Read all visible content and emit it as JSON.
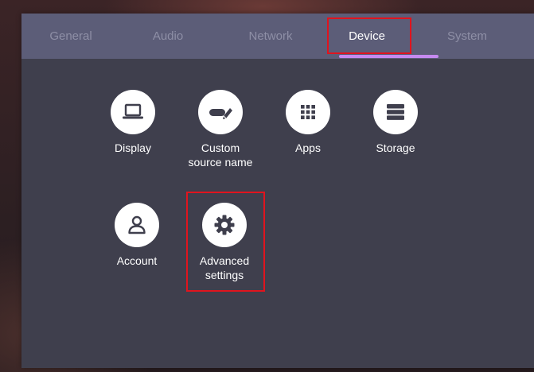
{
  "tabs": [
    {
      "label": "General",
      "active": false
    },
    {
      "label": "Audio",
      "active": false
    },
    {
      "label": "Network",
      "active": false
    },
    {
      "label": "Device",
      "active": true
    },
    {
      "label": "System",
      "active": false
    }
  ],
  "device_items": [
    {
      "label": "Display",
      "icon": "laptop-icon"
    },
    {
      "label": "Custom\nsource name",
      "icon": "tag-pen-icon"
    },
    {
      "label": "Apps",
      "icon": "apps-grid-icon"
    },
    {
      "label": "Storage",
      "icon": "storage-icon"
    },
    {
      "label": "Account",
      "icon": "person-icon"
    },
    {
      "label": "Advanced\nsettings",
      "icon": "gear-icon"
    }
  ],
  "colors": {
    "panel": "#3f3f4d",
    "tab_bar": "#5c5d78",
    "tab_inactive_text": "#8e8fa6",
    "tab_active_text": "#ffffff",
    "tab_underline": "#c58af0",
    "highlight_box": "#e0141e",
    "icon_circle": "#ffffff",
    "icon_glyph": "#3f3f4d"
  }
}
